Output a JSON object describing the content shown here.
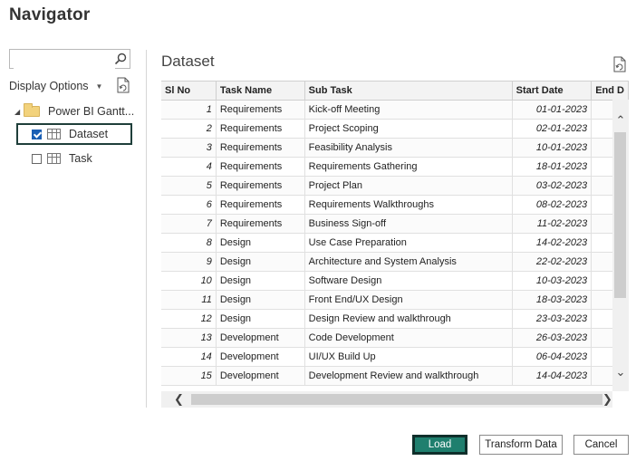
{
  "window": {
    "title": "Navigator"
  },
  "left_pane": {
    "search": {
      "value": "",
      "placeholder": ""
    },
    "display_options_label": "Display Options",
    "tree": {
      "folder_label": "Power BI Gantt...",
      "items": [
        {
          "label": "Dataset",
          "checked": true
        },
        {
          "label": "Task",
          "checked": false
        }
      ]
    }
  },
  "preview": {
    "title": "Dataset",
    "columns": [
      "Sl No",
      "Task Name",
      "Sub Task",
      "Start Date",
      "End D"
    ],
    "rows": [
      [
        "1",
        "Requirements",
        "Kick-off Meeting",
        "01-01-2023",
        ""
      ],
      [
        "2",
        "Requirements",
        "Project Scoping",
        "02-01-2023",
        ""
      ],
      [
        "3",
        "Requirements",
        "Feasibility Analysis",
        "10-01-2023",
        ""
      ],
      [
        "4",
        "Requirements",
        "Requirements Gathering",
        "18-01-2023",
        ""
      ],
      [
        "5",
        "Requirements",
        "Project Plan",
        "03-02-2023",
        ""
      ],
      [
        "6",
        "Requirements",
        "Requirements Walkthroughs",
        "08-02-2023",
        ""
      ],
      [
        "7",
        "Requirements",
        "Business Sign-off",
        "11-02-2023",
        ""
      ],
      [
        "8",
        "Design",
        "Use Case Preparation",
        "14-02-2023",
        ""
      ],
      [
        "9",
        "Design",
        "Architecture and System Analysis",
        "22-02-2023",
        ""
      ],
      [
        "10",
        "Design",
        "Software Design",
        "10-03-2023",
        ""
      ],
      [
        "11",
        "Design",
        "Front End/UX Design",
        "18-03-2023",
        ""
      ],
      [
        "12",
        "Design",
        "Design Review and walkthrough",
        "23-03-2023",
        ""
      ],
      [
        "13",
        "Development",
        "Code Development",
        "26-03-2023",
        ""
      ],
      [
        "14",
        "Development",
        "UI/UX Build Up",
        "06-04-2023",
        ""
      ],
      [
        "15",
        "Development",
        "Development Review and walkthrough",
        "14-04-2023",
        ""
      ]
    ]
  },
  "buttons": {
    "load": "Load",
    "transform": "Transform Data",
    "cancel": "Cancel"
  },
  "colors": {
    "load_button": "#1f7f6e",
    "selection_border": "#1f3f3a",
    "checkbox_checked": "#1a5fb4"
  }
}
